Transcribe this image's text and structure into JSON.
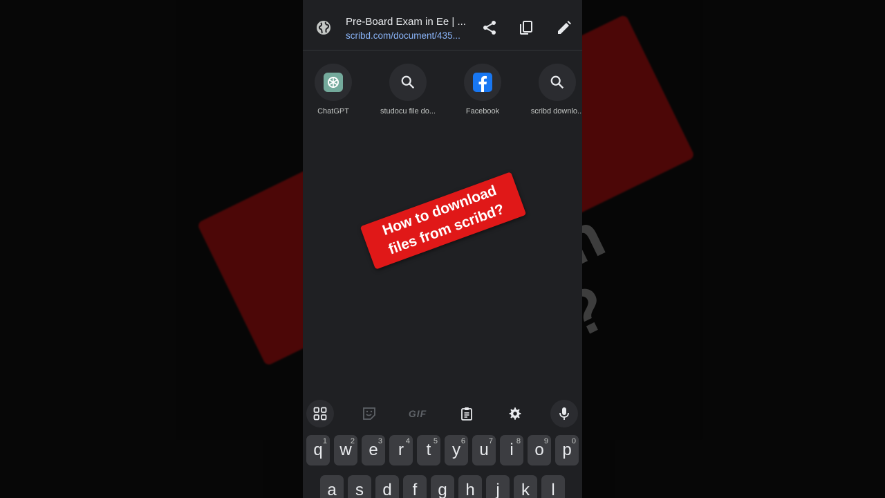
{
  "background": {
    "caption_lines": [
      "How to download",
      "files from scribd?"
    ]
  },
  "address_bar": {
    "title": "Pre-Board Exam in Ee | ...",
    "url": "scribd.com/document/435..."
  },
  "shortcuts": [
    {
      "label": "ChatGPT",
      "icon": "chatgpt-icon"
    },
    {
      "label": "studocu file do...",
      "icon": "search-icon"
    },
    {
      "label": "Facebook",
      "icon": "facebook-icon"
    },
    {
      "label": "scribd downlo...",
      "icon": "search-icon"
    }
  ],
  "overlay": {
    "line1": "How to download",
    "line2": "files from scribd?"
  },
  "keyboard": {
    "toolbar": {
      "gif_label": "GIF"
    },
    "row1": [
      {
        "k": "q",
        "n": "1"
      },
      {
        "k": "w",
        "n": "2"
      },
      {
        "k": "e",
        "n": "3"
      },
      {
        "k": "r",
        "n": "4"
      },
      {
        "k": "t",
        "n": "5"
      },
      {
        "k": "y",
        "n": "6"
      },
      {
        "k": "u",
        "n": "7"
      },
      {
        "k": "i",
        "n": "8"
      },
      {
        "k": "o",
        "n": "9"
      },
      {
        "k": "p",
        "n": "0"
      }
    ],
    "row2": [
      "a",
      "s",
      "d",
      "f",
      "g",
      "h",
      "j",
      "k",
      "l"
    ]
  },
  "colors": {
    "accent_red": "#e01818",
    "url_blue": "#8ab4f8",
    "panel_bg": "#1f2023"
  }
}
